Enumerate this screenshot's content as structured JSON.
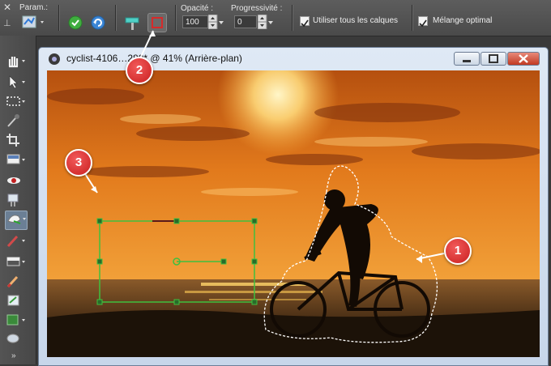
{
  "options_bar": {
    "params_label": "Param.:",
    "opacity_label": "Opacité :",
    "opacity_value": "100",
    "progressivity_label": "Progressivité :",
    "progressivity_value": "0",
    "use_all_layers_label": "Utiliser tous les calques",
    "use_all_layers_checked": true,
    "optimal_blend_label": "Mélange optimal",
    "optimal_blend_checked": true
  },
  "toolbar": {
    "tools": [
      "pan-tool",
      "pick-tool",
      "selection-tool",
      "dropper-tool",
      "crop-tool",
      "straighten-tool",
      "red-eye-tool",
      "clone-tool",
      "object-remover-tool",
      "paint-brush-tool",
      "gradient-tool",
      "eraser-tool",
      "fill-tool",
      "shape-tool",
      "smudge-tool"
    ]
  },
  "document": {
    "title": "cyclist-4106…280* @  41% (Arrière-plan)"
  },
  "callouts": [
    "1",
    "2",
    "3"
  ],
  "colors": {
    "accent_callout": "#d42a2a",
    "selection_box": "#3fbf3f",
    "sky_top": "#c25a12",
    "sky_glow": "#ffd97a"
  }
}
